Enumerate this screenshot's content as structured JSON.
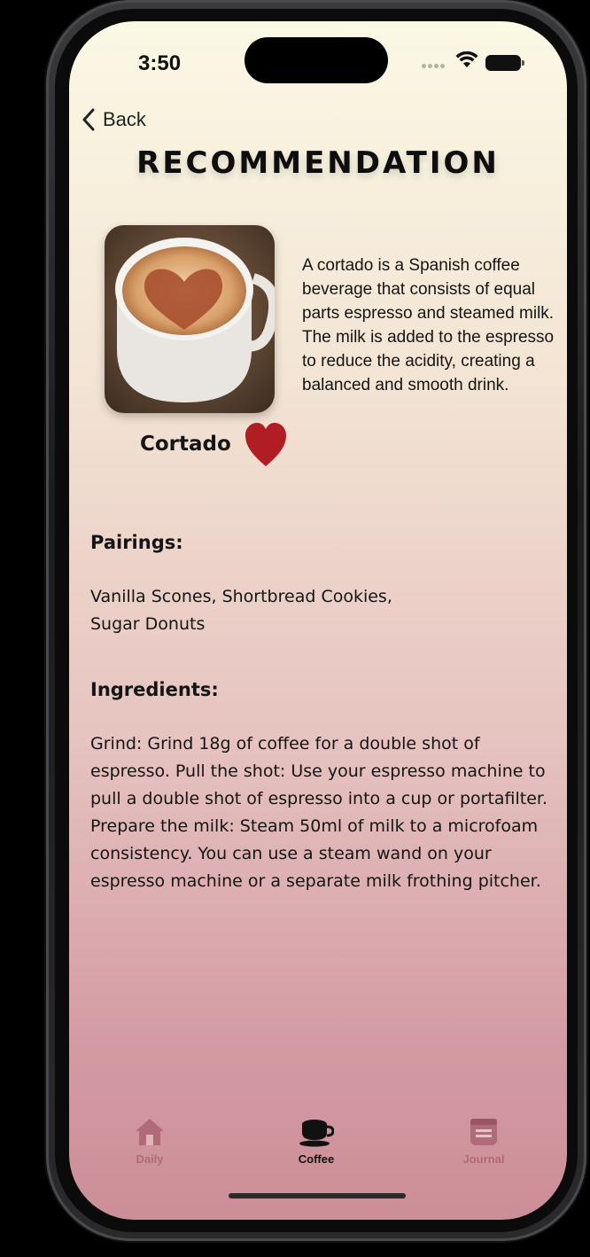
{
  "status_bar": {
    "time": "3:50"
  },
  "nav": {
    "back_label": "Back"
  },
  "page": {
    "title": "RECOMMENDATION"
  },
  "coffee": {
    "name": "Cortado",
    "description": "A cortado is a Spanish coffee beverage that consists of equal parts espresso and steamed milk. The milk is added to the espresso to reduce the acidity, creating a balanced and smooth drink.",
    "favorite_color": "#b01e23"
  },
  "pairings": {
    "heading": "Pairings:",
    "text_line1": "Vanilla Scones, Shortbread Cookies,",
    "text_line2": "Sugar Donuts"
  },
  "ingredients": {
    "heading": "Ingredients:",
    "lines": [
      "Grind: Grind 18g of coffee for a double shot of",
      "espresso. Pull the shot: Use your espresso machine to",
      "pull a double shot of espresso into a cup or portafilter.",
      "Prepare the milk: Steam 50ml of milk to a microfoam",
      "consistency. You can use a steam wand on your",
      "espresso machine or a separate milk frothing pitcher."
    ]
  },
  "tab_bar": {
    "tabs": [
      {
        "label": "Daily",
        "icon": "house-icon",
        "active": false
      },
      {
        "label": "Coffee",
        "icon": "coffee-cup-icon",
        "active": true
      },
      {
        "label": "Journal",
        "icon": "journal-icon",
        "active": false
      }
    ],
    "active_color": "#111111",
    "inactive_color": "#b06a78"
  }
}
